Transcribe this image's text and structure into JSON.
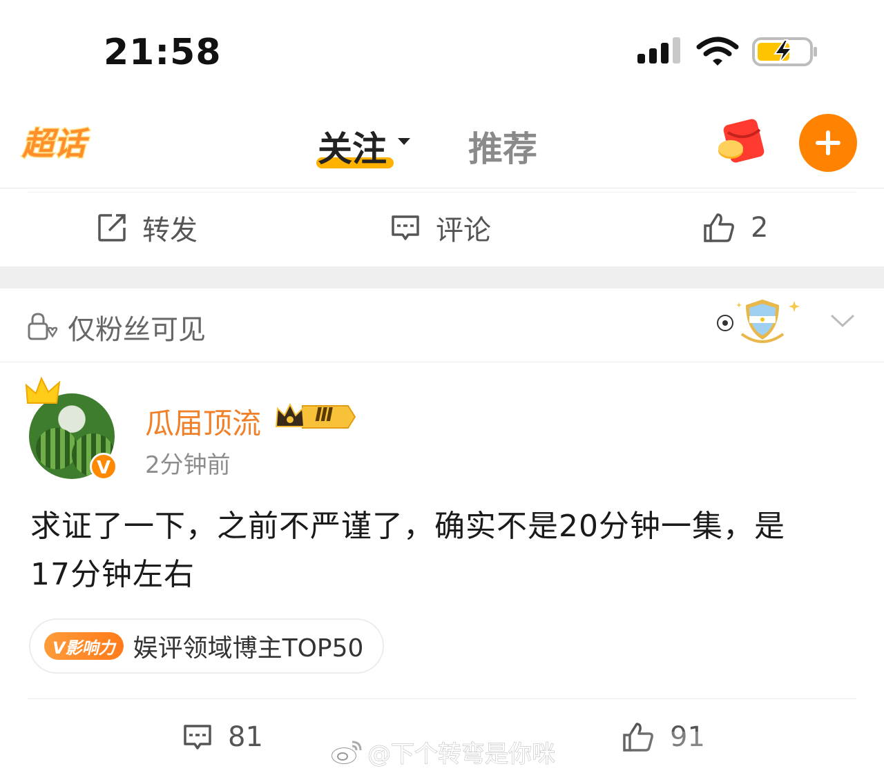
{
  "status_bar": {
    "time": "21:58"
  },
  "header": {
    "logo_text": "超话",
    "tabs": [
      {
        "label": "关注",
        "active": true
      },
      {
        "label": "推荐",
        "active": false
      }
    ],
    "accent": "#ff8200"
  },
  "prev_post_actions": {
    "repost_label": "转发",
    "comment_label": "评论",
    "like_count": "2"
  },
  "post": {
    "visibility": "仅粉丝可见",
    "author": {
      "name": "瓜届顶流",
      "level": "Ⅲ",
      "verified": "V"
    },
    "time": "2分钟前",
    "text_line1": "求证了一下，之前不严谨了，确实不是20分钟一集，是",
    "text_line2": "17分钟左右",
    "influence_tag": {
      "chip": "V影响力",
      "text": "娱评领域博主TOP50"
    },
    "comment_count": "81",
    "like_count": "91"
  },
  "watermark": "@下个转弯是你咪"
}
